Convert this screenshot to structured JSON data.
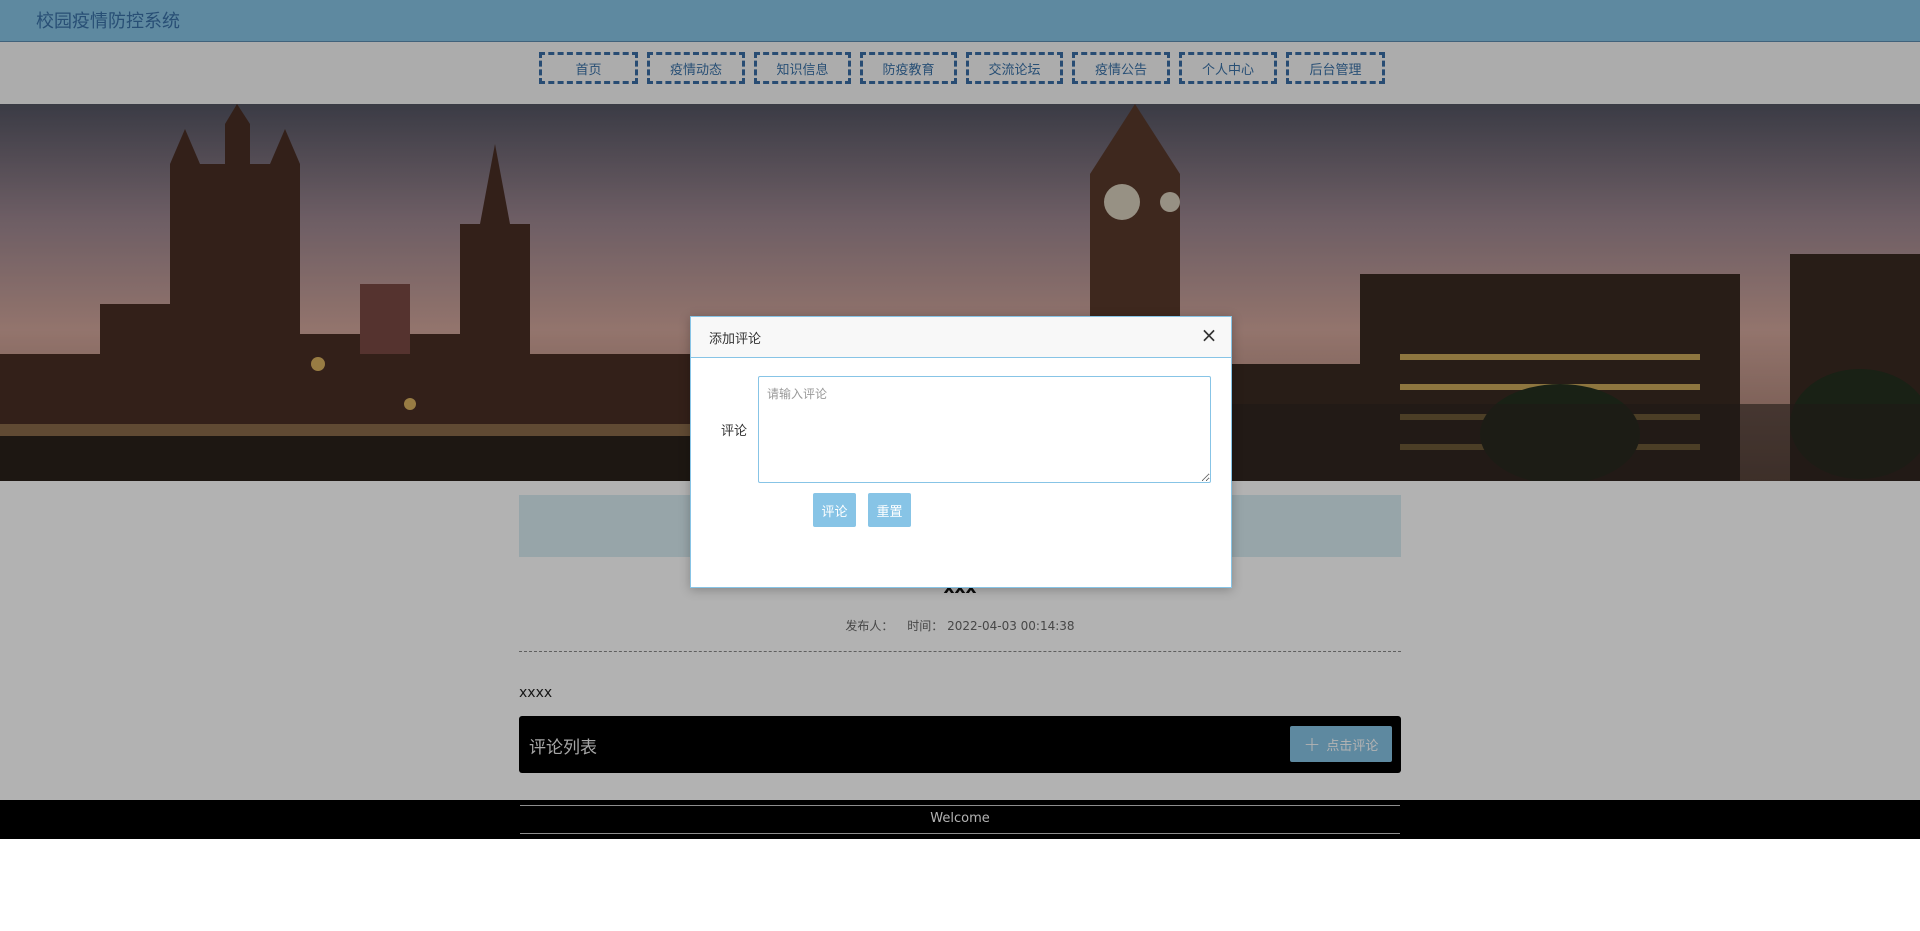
{
  "app": {
    "title": "校园疫情防控系统"
  },
  "nav": {
    "items": [
      {
        "label": "首页"
      },
      {
        "label": "疫情动态"
      },
      {
        "label": "知识信息"
      },
      {
        "label": "防疫教育"
      },
      {
        "label": "交流论坛"
      },
      {
        "label": "疫情公告"
      },
      {
        "label": "个人中心"
      },
      {
        "label": "后台管理"
      }
    ]
  },
  "post": {
    "title": "xxx",
    "publisher_label": "发布人：",
    "time_label": "时间：",
    "time": "2022-04-03 00:14:38",
    "body": "xxxx"
  },
  "comments": {
    "header": "评论列表",
    "add_button": "点击评论",
    "add_icon": "plus-icon"
  },
  "footer": {
    "text": "Welcome"
  },
  "dialog": {
    "title": "添加评论",
    "close_icon": "close-icon",
    "field_label": "评论",
    "textarea_value": "",
    "textarea_placeholder": "请输入评论",
    "submit_label": "评论",
    "reset_label": "重置"
  },
  "colors": {
    "accent": "#87c4e6",
    "nav_border": "#3a6ea5",
    "comments_bar": "#000000",
    "footer": "#000000"
  }
}
